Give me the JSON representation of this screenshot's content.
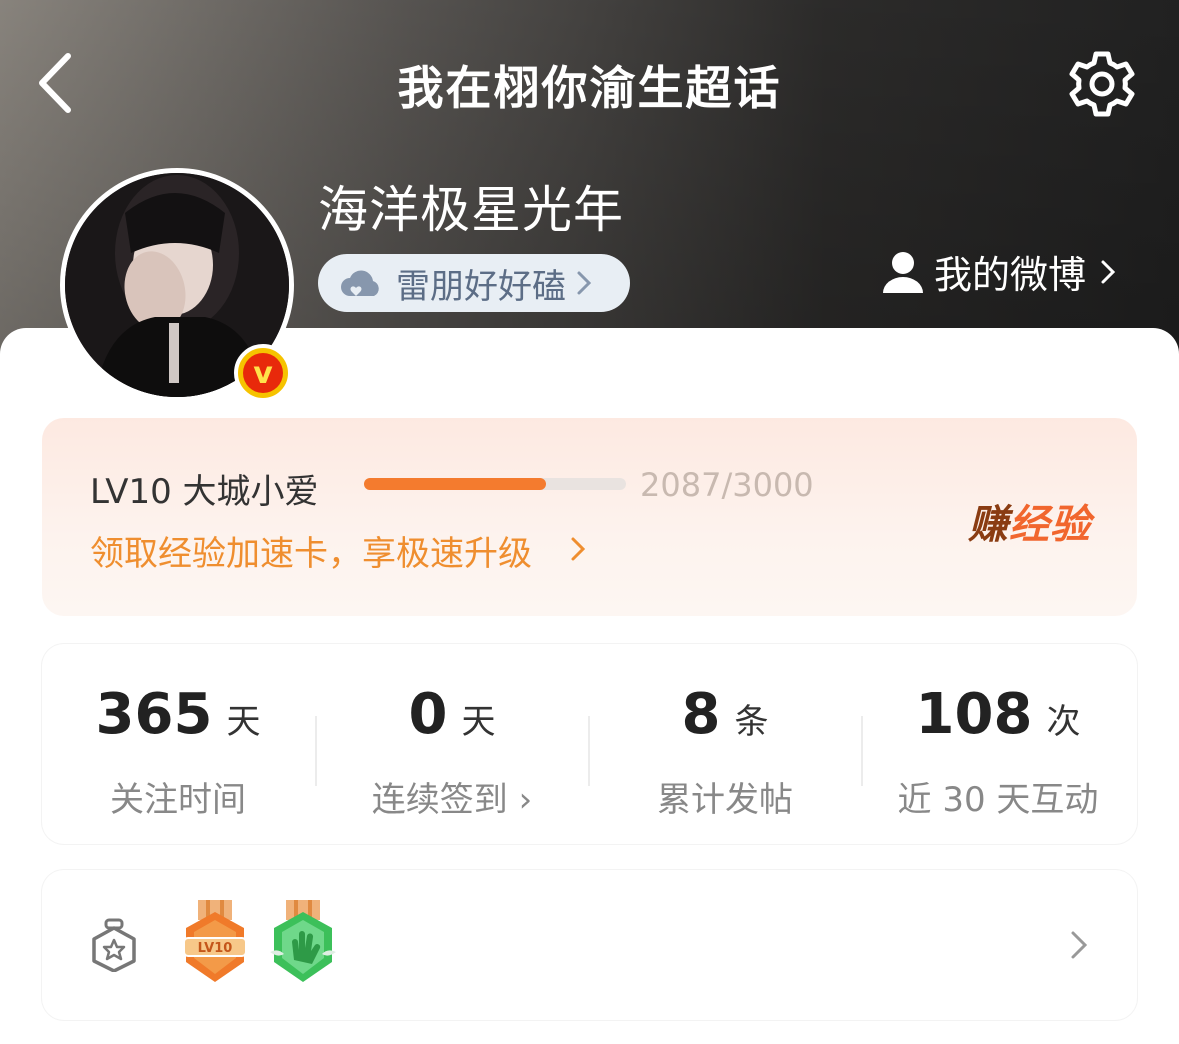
{
  "header": {
    "title": "我在栩你渝生超话",
    "username": "海洋极星光年",
    "tag": "雷朋好好磕",
    "my_weibo": "我的微博"
  },
  "level": {
    "name": "LV10 大城小爱",
    "progress_text": "2087/3000",
    "progress_fraction": 0.6957,
    "boost_text": "领取经验加速卡，享极速升级",
    "earn_part1": "赚",
    "earn_part2": "经验"
  },
  "stats": [
    {
      "value": "365",
      "unit": "天",
      "label": "关注时间"
    },
    {
      "value": "0",
      "unit": "天",
      "label": "连续签到 ›"
    },
    {
      "value": "8",
      "unit": "条",
      "label": "累计发帖"
    },
    {
      "value": "108",
      "unit": "次",
      "label": "近 30 天互动"
    }
  ],
  "badges": {
    "items": [
      {
        "name": "LV10",
        "color": "#f07a2a"
      },
      {
        "name": "hand",
        "color": "#3cc05a"
      }
    ]
  },
  "icons": {
    "back": "chevron-left-icon",
    "settings": "gear-icon",
    "cloud": "cloud-heart-icon",
    "user": "user-icon",
    "verified": "v"
  },
  "colors": {
    "accent_orange": "#f47b2e",
    "boost_text": "#ef8e2f",
    "verified_yellow": "#f6c300",
    "verified_red": "#e8290b"
  }
}
